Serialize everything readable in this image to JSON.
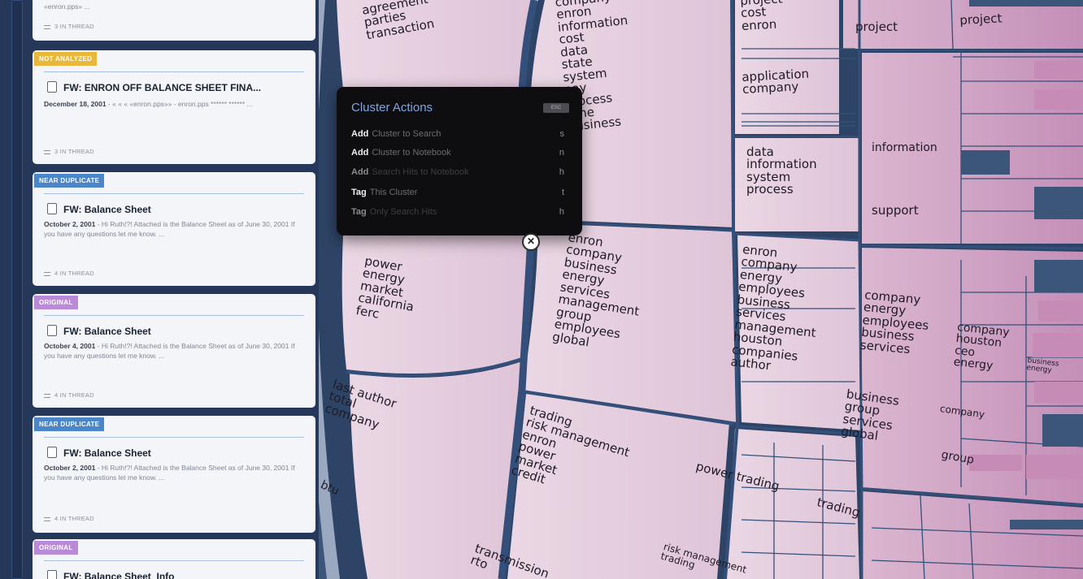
{
  "colors": {
    "page_bg": "#2e4466",
    "panel_bg": "#25385a",
    "card_bg": "#f4f5f8",
    "cell_fill": "#e6cfe0",
    "cell_fill_dark": "#cf9fc2",
    "popup_bg": "#0e0d10",
    "popup_title": "#7fa7e4"
  },
  "results": {
    "top_card": {
      "snippet": "«enron.pps» ...",
      "thread": "3 IN THREAD"
    },
    "cards": [
      {
        "badge": "NOT ANALYZED",
        "badge_color": "yellow",
        "title": "FW: ENRON OFF BALANCE SHEET FINA...",
        "date": "December 18, 2001",
        "snippet": " - « « « «enron.pps»» - enron.pps ****** ****** ...",
        "thread": "3 IN THREAD"
      },
      {
        "badge": "NEAR DUPLICATE",
        "badge_color": "blue",
        "title": "FW: Balance Sheet",
        "date": "October 2, 2001",
        "snippet": " - Hi Ruth!?! Attached is the Balance Sheet as of June 30, 2001 If you have any questions let me know. ...",
        "thread": "4 IN THREAD"
      },
      {
        "badge": "ORIGINAL",
        "badge_color": "purple",
        "title": "FW: Balance Sheet",
        "date": "October 4, 2001",
        "snippet": " - Hi Ruth!?! Attached is the Balance Sheet as of June 30, 2001 If you have any questions let me know. ...",
        "thread": "4 IN THREAD"
      },
      {
        "badge": "NEAR DUPLICATE",
        "badge_color": "blue",
        "title": "FW: Balance Sheet",
        "date": "October 2, 2001",
        "snippet": " - Hi Ruth!?! Attached is the Balance Sheet as of June 30, 2001 If you have any questions let me know. ...",
        "thread": "4 IN THREAD"
      },
      {
        "badge": "ORIGINAL",
        "badge_color": "purple",
        "title": "FW: Balance Sheet_Info",
        "date": "",
        "snippet": "",
        "thread": ""
      }
    ]
  },
  "clusters": [
    {
      "terms": [
        "agreement",
        "parties",
        "transaction"
      ]
    },
    {
      "terms": [
        "company",
        "enron",
        "information",
        "cost",
        "data",
        "state",
        "system",
        "pay",
        "process",
        "time",
        "business"
      ]
    },
    {
      "terms": [
        "project",
        "cost",
        "enron"
      ]
    },
    {
      "terms": [
        "project"
      ]
    },
    {
      "terms": [
        "project"
      ]
    },
    {
      "terms": [
        "application",
        "company"
      ]
    },
    {
      "terms": [
        "data",
        "information",
        "system",
        "process"
      ]
    },
    {
      "terms": [
        "information"
      ]
    },
    {
      "terms": [
        "support"
      ]
    },
    {
      "terms": [
        "power",
        "energy",
        "market",
        "california",
        "ferc"
      ]
    },
    {
      "terms": [
        "enron",
        "company",
        "business",
        "energy",
        "services",
        "management",
        "group",
        "employees",
        "global"
      ]
    },
    {
      "terms": [
        "enron",
        "company",
        "energy",
        "employees",
        "business",
        "services",
        "management",
        "houston",
        "companies",
        "author"
      ]
    },
    {
      "terms": [
        "company",
        "energy",
        "employees",
        "business",
        "services"
      ]
    },
    {
      "terms": [
        "company",
        "houston",
        "ceo",
        "energy"
      ]
    },
    {
      "terms": [
        "business",
        "energy"
      ]
    },
    {
      "terms": [
        "last author",
        "total",
        "company"
      ]
    },
    {
      "terms": [
        "trading",
        "risk management",
        "enron",
        "power",
        "market",
        "credit"
      ]
    },
    {
      "terms": [
        "business",
        "group",
        "services",
        "global"
      ]
    },
    {
      "terms": [
        "company"
      ]
    },
    {
      "terms": [
        "group"
      ]
    },
    {
      "terms": [
        "power trading"
      ]
    },
    {
      "terms": [
        "trading"
      ]
    },
    {
      "terms": [
        "risk management",
        "trading"
      ]
    },
    {
      "terms": [
        "transmission",
        "rto"
      ]
    },
    {
      "terms": [
        "btu"
      ]
    }
  ],
  "popup": {
    "title": "Cluster Actions",
    "esc_label": "ESC",
    "items": [
      {
        "verb": "Add",
        "object": "Cluster to Search",
        "key": "s",
        "enabled": true
      },
      {
        "verb": "Add",
        "object": "Cluster to Notebook",
        "key": "n",
        "enabled": true
      },
      {
        "verb": "Add",
        "object": "Search Hits to Notebook",
        "key": "h",
        "enabled": false
      },
      {
        "verb": "Tag",
        "object": "This Cluster",
        "key": "t",
        "enabled": true
      },
      {
        "verb": "Tag",
        "object": "Only Search Hits",
        "key": "h",
        "enabled": false
      }
    ],
    "close_label": "✕"
  }
}
